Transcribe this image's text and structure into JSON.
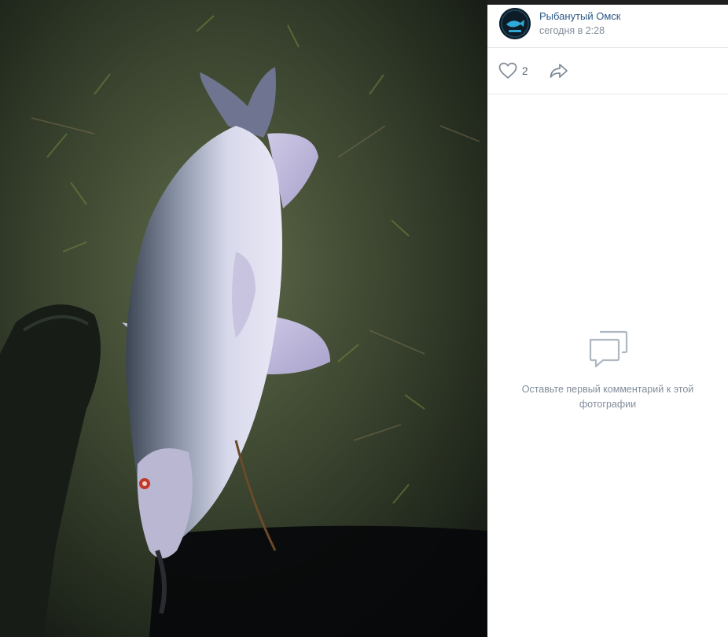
{
  "post": {
    "author": "Рыбанутый Омск",
    "date": "сегодня в 2:28",
    "avatar_icon": "group-avatar-fish-logo"
  },
  "actions": {
    "likes": "2",
    "like_icon": "heart-icon",
    "share_icon": "share-arrow-icon"
  },
  "comments": {
    "empty_icon": "comments-bubble-icon",
    "empty_text": "Оставьте первый комментарий к этой фотографии"
  },
  "photo": {
    "subject": "pike-fish-on-grass-photo"
  },
  "colors": {
    "link": "#2a5885",
    "secondary_text": "#818c99",
    "divider": "#e7e8ec"
  }
}
